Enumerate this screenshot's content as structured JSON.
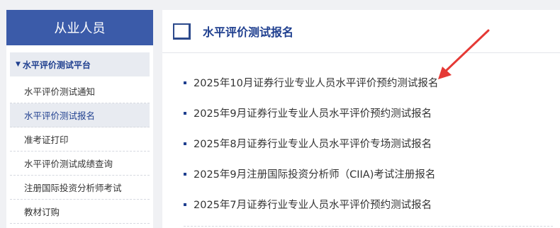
{
  "sidebar": {
    "header": "从业人员",
    "section_title": "水平评价测试平台",
    "items": [
      {
        "label": "水平评价测试通知"
      },
      {
        "label": "水平评价测试报名"
      },
      {
        "label": "准考证打印"
      },
      {
        "label": "水平评价测试成绩查询"
      },
      {
        "label": "注册国际投资分析师考试"
      },
      {
        "label": "教材订购"
      }
    ],
    "active_index": 1
  },
  "main": {
    "title": "水平评价测试报名",
    "news": [
      {
        "title": "2025年10月证券行业专业人员水平评价预约测试报名"
      },
      {
        "title": "2025年9月证券行业专业人员水平评价预约测试报名"
      },
      {
        "title": "2025年8月证券行业专业人员水平评价专场测试报名"
      },
      {
        "title": "2025年9月注册国际投资分析师（CIIA)考试注册报名"
      },
      {
        "title": "2025年7月证券行业专业人员水平评价预约测试报名"
      }
    ]
  },
  "annotation": {
    "arrow_color": "#e53935"
  },
  "colors": {
    "brand": "#3b5ba9",
    "accent": "#1f3f8f",
    "background": "#f0f1f4"
  }
}
